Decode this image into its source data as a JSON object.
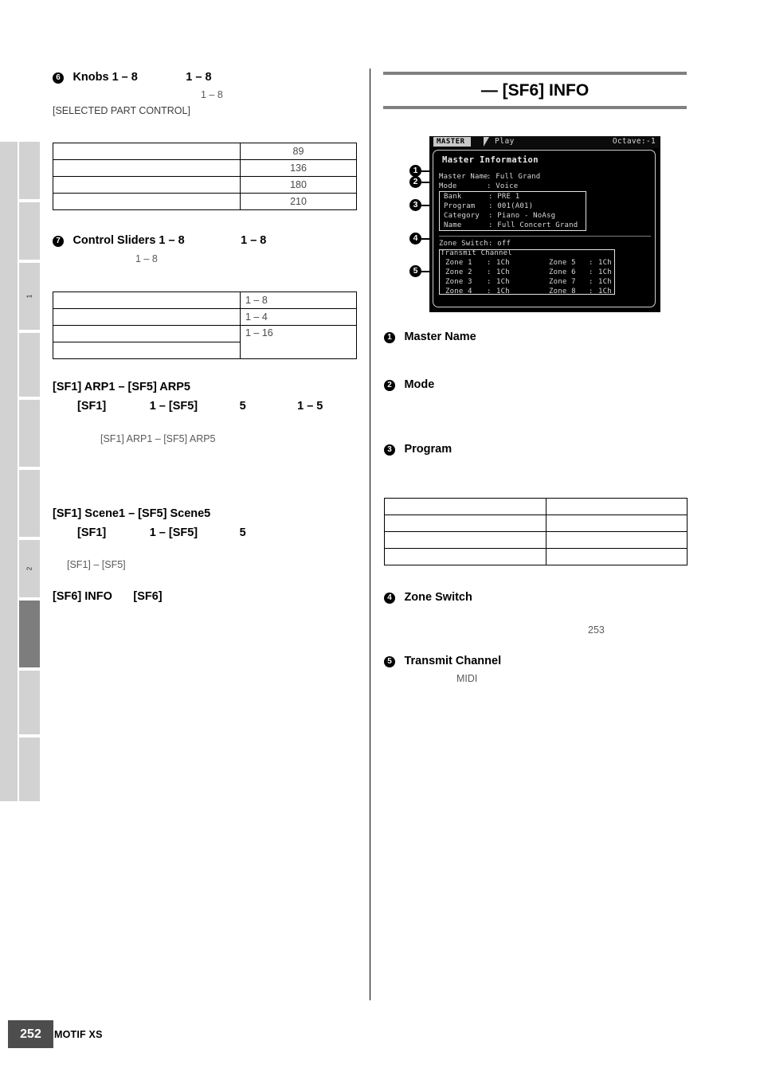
{
  "page": {
    "number": "252",
    "product": "MOTIF XS"
  },
  "sidebar": {
    "tabs": [
      {
        "label": ""
      },
      {
        "label": ""
      },
      {
        "label": "1"
      },
      {
        "label": ""
      },
      {
        "label": ""
      },
      {
        "label": ""
      },
      {
        "label": "2"
      },
      {
        "label": ""
      },
      {
        "label": ""
      },
      {
        "label": ""
      }
    ]
  },
  "left_column": {
    "knobs": {
      "badge": "6",
      "heading": "Knobs 1 – 8",
      "heading_range": "1 – 8",
      "sub_range": "1 – 8",
      "note": "[SELECTED PART CONTROL]",
      "table": {
        "rows": [
          {
            "label": "",
            "value": "89"
          },
          {
            "label": "",
            "value": "136"
          },
          {
            "label": "",
            "value": "180"
          },
          {
            "label": "",
            "value": "210"
          }
        ]
      }
    },
    "sliders": {
      "badge": "7",
      "heading": "Control Sliders 1 – 8",
      "heading_range": "1 – 8",
      "sub_range": "1 – 8",
      "table": {
        "rows": [
          {
            "label": "",
            "value": "1 – 8"
          },
          {
            "label": "",
            "value": "1 – 4"
          },
          {
            "label": "",
            "value": "1 – 16"
          },
          {
            "label": "",
            "value": ""
          }
        ]
      }
    },
    "arp": {
      "heading": "[SF1] ARP1 – [SF5] ARP5",
      "subheading_a": "[SF1]",
      "subheading_b": "1 – [SF5]",
      "subheading_c": "5",
      "subheading_d": "1 – 5",
      "note": "[SF1] ARP1 – [SF5] ARP5"
    },
    "scene": {
      "heading": "[SF1] Scene1 – [SF5] Scene5",
      "subheading_a": "[SF1]",
      "subheading_b": "1 – [SF5]",
      "subheading_c": "5",
      "note": "[SF1] – [SF5]"
    },
    "info": {
      "heading": "[SF6] INFO",
      "heading_b": "[SF6]"
    }
  },
  "right_column": {
    "section_title": "— [SF6] INFO",
    "lcd": {
      "mode_chip": "MASTER",
      "play_label": "Play",
      "octave_label": "Octave:-1",
      "screen_title": "Master Information",
      "master_name_label": "Master Name",
      "master_name_value": ": Full Grand",
      "mode_label": "Mode",
      "mode_value": ": Voice",
      "program_box": [
        {
          "label": "Bank",
          "value": ": PRE 1"
        },
        {
          "label": "Program",
          "value": ": 001(A01)"
        },
        {
          "label": "Category",
          "value": ": Piano - NoAsg"
        },
        {
          "label": "Name",
          "value": ": Full Concert Grand"
        }
      ],
      "zone_switch_label": "Zone Switch",
      "zone_switch_value": ": off",
      "transmit_channel_title": "Transmit Channel",
      "zones_left": [
        {
          "label": "Zone 1",
          "sep": ":",
          "value": "1Ch"
        },
        {
          "label": "Zone 2",
          "sep": ":",
          "value": "1Ch"
        },
        {
          "label": "Zone 3",
          "sep": ":",
          "value": "1Ch"
        },
        {
          "label": "Zone 4",
          "sep": ":",
          "value": "1Ch"
        }
      ],
      "zones_right": [
        {
          "label": "Zone 5",
          "sep": ":",
          "value": "1Ch"
        },
        {
          "label": "Zone 6",
          "sep": ":",
          "value": "1Ch"
        },
        {
          "label": "Zone 7",
          "sep": ":",
          "value": "1Ch"
        },
        {
          "label": "Zone 8",
          "sep": ":",
          "value": "1Ch"
        }
      ]
    },
    "callouts": [
      {
        "badge": "1",
        "label": "Master Name"
      },
      {
        "badge": "2",
        "label": "Mode"
      },
      {
        "badge": "3",
        "label": "Program"
      },
      {
        "badge": "4",
        "label": "Zone Switch"
      },
      {
        "badge": "5",
        "label": "Transmit Channel"
      }
    ],
    "program_table": {
      "rows": [
        {
          "left": "",
          "right": ""
        },
        {
          "left": "",
          "right": ""
        },
        {
          "left": "",
          "right": ""
        },
        {
          "left": "",
          "right": ""
        }
      ]
    },
    "zone_switch_ref": "253",
    "transmit_note": "MIDI"
  },
  "colors": {
    "rule": "#808080",
    "sidebar": "#d2d2d2",
    "sidebar_active": "#7d7d7d",
    "footer_box": "#4d4d4d",
    "lcd_bg": "#000000",
    "gray_text": "#5a5a5a"
  }
}
